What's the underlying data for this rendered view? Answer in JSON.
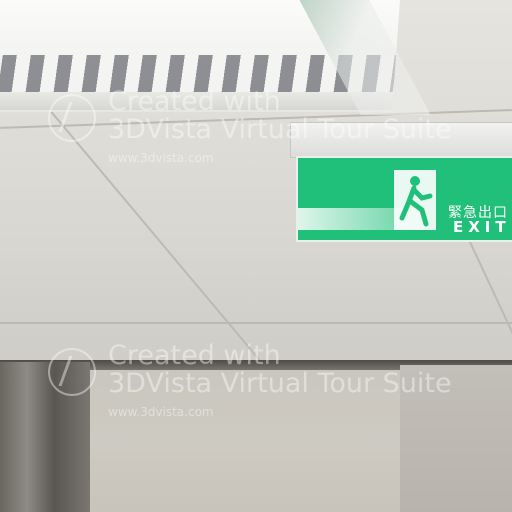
{
  "exit_sign": {
    "chinese_text": "緊急出口",
    "english_text": "EXIT",
    "color": "#20c07a"
  },
  "watermark": {
    "line1": "Created with",
    "line2": "3DVista Virtual Tour Suite",
    "url": "www.3dvista.com"
  },
  "watermark_repeat": {
    "line1": "Created with",
    "line2": "3DVista Virtual Tour Suite",
    "url": "www.3dvista.com"
  }
}
